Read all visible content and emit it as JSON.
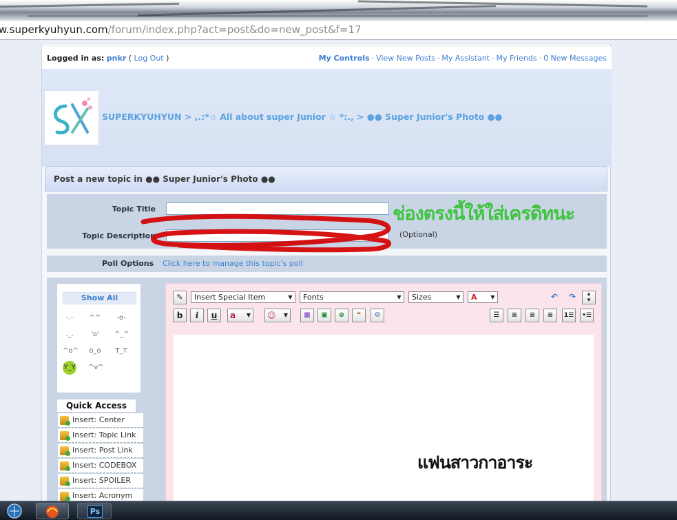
{
  "browser": {
    "url_domain": "w.superkyuhyun.com",
    "url_path": "/forum/index.php?act=post&do=new_post&f=17"
  },
  "userbar": {
    "logged_in_label": "Logged in as:",
    "username": "pnkr",
    "logout": "Log Out",
    "links": [
      "My Controls",
      "View New Posts",
      "My Assistant",
      "My Friends",
      "0 New Messages"
    ]
  },
  "banner": {
    "breadcrumb": "SUPERKYUHYUN > ,.:*☆ All about super Junior ☆ *:., > ●● Super Junior's Photo ●●"
  },
  "post": {
    "header": "Post a new topic in ●● Super Junior's Photo ●●",
    "topic_title_label": "Topic Title",
    "topic_title_value": "",
    "topic_description_label": "Topic Description",
    "topic_description_value": "",
    "optional": "(Optional)",
    "poll_label": "Poll Options",
    "poll_link": "Click here to manage this topic's poll"
  },
  "emoticons": {
    "show_all": "Show All",
    "items": [
      "-.-",
      "^^",
      "-o-",
      "._.",
      "'o'",
      "^_^",
      "^o^",
      "o_o",
      "T_T",
      "Y_Y",
      "^v^"
    ]
  },
  "quick_access": {
    "title": "Quick Access",
    "items": [
      "Insert: Center",
      "Insert: Topic Link",
      "Insert: Post Link",
      "Insert: CODEBOX",
      "Insert: SPOILER",
      "Insert: Acronym"
    ]
  },
  "editor": {
    "special_item": "Insert Special Item",
    "fonts": "Fonts",
    "sizes": "Sizes",
    "body": ""
  },
  "annotations": {
    "green_text": "ช่องตรงนี้ให้ใส่เครดิทนะ",
    "black_text": "แฟนสาวกาอาระ",
    "green_color": "#3ec43e",
    "scribble_color": "#d40000"
  },
  "taskbar": {
    "ps_label": "Ps"
  }
}
